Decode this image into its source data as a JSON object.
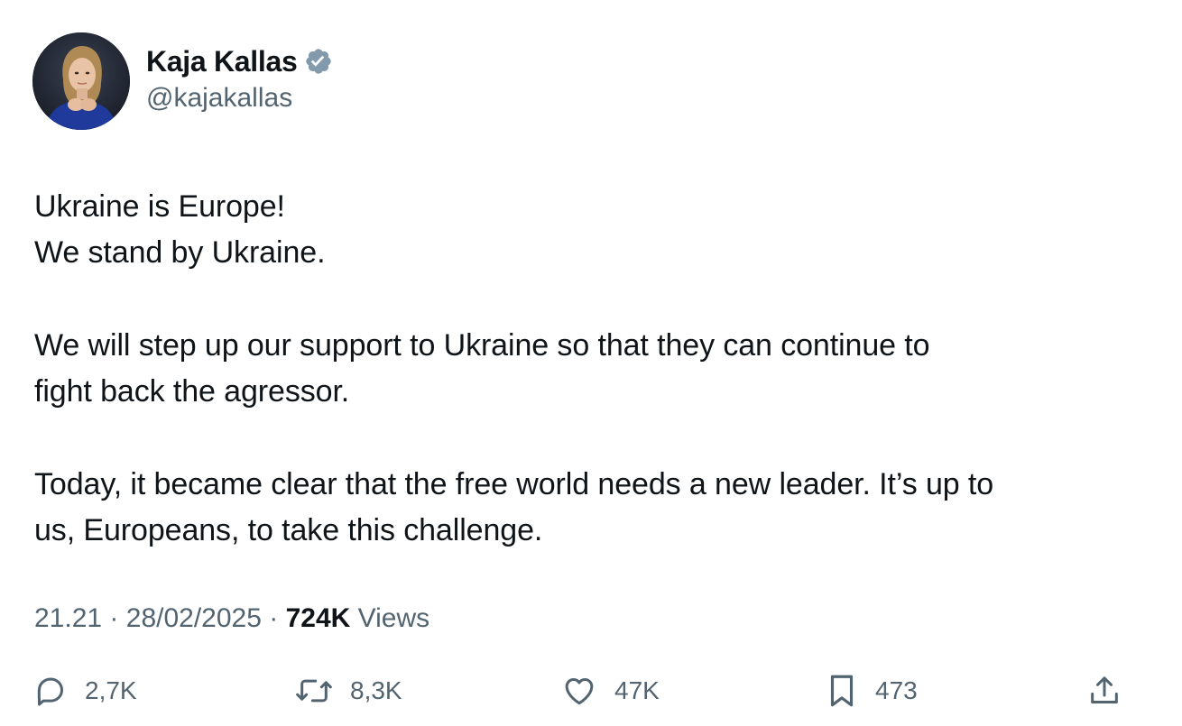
{
  "author": {
    "display_name": "Kaja Kallas",
    "handle": "@kajakallas",
    "verified": true,
    "verified_badge_color": "#829aab",
    "avatar_icon": "profile-photo"
  },
  "tweet": {
    "paragraphs": [
      [
        "Ukraine is Europe!",
        "We stand by Ukraine."
      ],
      [
        "We will step up our support to Ukraine so that they can continue to",
        "fight back the agressor."
      ],
      [
        "Today, it became clear that the free world needs a new leader. It’s up to",
        "us, Europeans, to take this challenge."
      ]
    ]
  },
  "meta": {
    "time": "21.21",
    "separator": "·",
    "date": "28/02/2025",
    "views_count": "724K",
    "views_label": "Views"
  },
  "actions": {
    "reply": {
      "icon": "reply-icon",
      "count": "2,7K"
    },
    "retweet": {
      "icon": "retweet-icon",
      "count": "8,3K"
    },
    "like": {
      "icon": "heart-icon",
      "count": "47K"
    },
    "bookmark": {
      "icon": "bookmark-icon",
      "count": "473"
    },
    "share": {
      "icon": "share-icon"
    }
  },
  "colors": {
    "text_primary": "#0f1419",
    "text_secondary": "#536471",
    "background": "#ffffff"
  }
}
